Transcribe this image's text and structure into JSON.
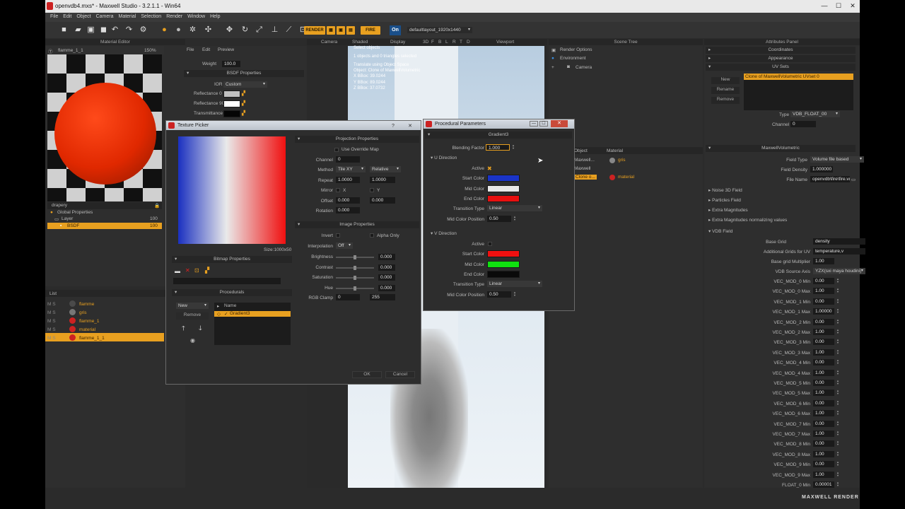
{
  "window": {
    "title": "openvdb4.mxs* - Maxwell Studio - 3.2.1.1 - Win64",
    "minimize": "—",
    "maximize": "☐",
    "close": "✕"
  },
  "menu": [
    "File",
    "Edit",
    "Object",
    "Camera",
    "Material",
    "Selection",
    "Render",
    "Window",
    "Help"
  ],
  "toolbar": {
    "render_label": "RENDER",
    "fire_label": "FIRE",
    "on_label": "On",
    "layout_label": "defaultlayout_1920x1440"
  },
  "material_editor": {
    "header": "Material Editor",
    "material_name": "flamme_1_1",
    "zoom": "150%",
    "preview_tab": "drapery",
    "menus": [
      "File",
      "Edit",
      "Preview"
    ],
    "weight_label": "Weight",
    "weight_value": "100.0",
    "bsdf_header": "BSDF Properties",
    "ior_label": "IOR",
    "ior_value": "Custom",
    "refl0_label": "Reflectance 0",
    "refl90_label": "Reflectance 90",
    "trans_label": "Transmittance",
    "tree": [
      {
        "label": "Global Properties",
        "value": ""
      },
      {
        "label": "Layer",
        "value": "100"
      },
      {
        "label": "BSDF",
        "value": "100"
      }
    ]
  },
  "list_panel": {
    "header": "List",
    "rows": [
      {
        "flags": "M  S",
        "name": "flamme"
      },
      {
        "flags": "M  S",
        "name": "gris"
      },
      {
        "flags": "M  S",
        "name": "flamme_1"
      },
      {
        "flags": "M  S",
        "name": "material"
      },
      {
        "flags": "M  S",
        "name": "flamme_1_1"
      }
    ]
  },
  "viewport": {
    "tabs": [
      "Camera",
      "Shaded",
      "Display",
      "3D",
      "F",
      "B",
      "L",
      "R",
      "T",
      "D",
      "Viewport"
    ],
    "info": [
      "Select objects",
      "1 objects and 0 triangles selected",
      "Translate using Object Space",
      "Object: Clone of MaxwellVolumetric",
      "X BBox: 39.0244",
      "Y BBox: 89.0244",
      "Z BBox: 37.0732"
    ]
  },
  "scene_tree": {
    "header": "Scene Tree",
    "items": [
      "Render Options",
      "Environment",
      "Camera"
    ],
    "columns": [
      "Object",
      "Material"
    ],
    "rows": [
      {
        "object": "Maxwell...",
        "material": "gris"
      },
      {
        "object": "Maxwell",
        "material": ""
      },
      {
        "object": "Clone o...",
        "material": "material"
      }
    ]
  },
  "attributes": {
    "header": "Attributes Panel",
    "sections": [
      "Coordinates",
      "Appearance",
      "UV Sets"
    ],
    "uv_name": "Clone of MaxwellVolumetric UVset 0",
    "buttons": [
      "New",
      "Rename",
      "Remove"
    ],
    "type_label": "Type",
    "type_value": "VDB_FLOAT_00",
    "channel_label": "Channel",
    "channel_value": "0",
    "volumetric_header": "MaxwellVolumetric",
    "field_type_label": "Field Type",
    "field_type_value": "Volume file based",
    "field_density_label": "Field Density",
    "field_density_value": "1.000000",
    "file_name_label": "File Name",
    "file_name_value": "openvdb\\fire\\fire.vdb",
    "collapsed": [
      "Noise 3D Field",
      "Particles Field",
      "Extra Magnitudes",
      "Extra Magnitudes normalizing values"
    ],
    "vdb_field": "VDB Field",
    "base_grid_label": "Base Grid",
    "base_grid_value": "density",
    "add_grids_label": "Additional Grids for UV",
    "add_grids_value": "temperature,v",
    "base_mult_label": "Base grid Multiplier",
    "base_mult_value": "1.00",
    "src_axis_label": "VDB Source Axis",
    "src_axis_value": "YZX(sxi maya houdini)",
    "vec_rows": [
      {
        "label": "VEC_MOD_0 Min",
        "value": "0.00"
      },
      {
        "label": "VEC_MOD_0 Max",
        "value": "1.00"
      },
      {
        "label": "VEC_MOD_1 Min",
        "value": "0.00"
      },
      {
        "label": "VEC_MOD_1 Max",
        "value": "1.00000"
      },
      {
        "label": "VEC_MOD_2 Min",
        "value": "0.00"
      },
      {
        "label": "VEC_MOD_2 Max",
        "value": "1.00"
      },
      {
        "label": "VEC_MOD_3 Min",
        "value": "0.00"
      },
      {
        "label": "VEC_MOD_3 Max",
        "value": "1.00"
      },
      {
        "label": "VEC_MOD_4 Min",
        "value": "0.00"
      },
      {
        "label": "VEC_MOD_4 Max",
        "value": "1.00"
      },
      {
        "label": "VEC_MOD_5 Min",
        "value": "0.00"
      },
      {
        "label": "VEC_MOD_5 Max",
        "value": "1.00"
      },
      {
        "label": "VEC_MOD_6 Min",
        "value": "0.00"
      },
      {
        "label": "VEC_MOD_6 Max",
        "value": "1.00"
      },
      {
        "label": "VEC_MOD_7 Min",
        "value": "0.00"
      },
      {
        "label": "VEC_MOD_7 Max",
        "value": "1.00"
      },
      {
        "label": "VEC_MOD_8 Min",
        "value": "0.00"
      },
      {
        "label": "VEC_MOD_8 Max",
        "value": "1.00"
      },
      {
        "label": "VEC_MOD_9 Min",
        "value": "0.00"
      },
      {
        "label": "VEC_MOD_9 Max",
        "value": "1.00"
      },
      {
        "label": "FLOAT_0 Min",
        "value": "0.00001"
      }
    ],
    "brand": "MAXWELL RENDER"
  },
  "texture_picker": {
    "title": "Texture Picker",
    "size_label": "Size:1000x50",
    "bitmap_header": "Bitmap Properties",
    "procedurals_header": "Procedurals",
    "new_label": "New",
    "remove_label": "Remove",
    "name_col": "Name",
    "procedural_item": "Gradient3",
    "projection_header": "Projection Properties",
    "use_override": "Use Override Map",
    "channel_label": "Channel",
    "channel_value": "0",
    "method_label": "Method",
    "method_value": "Tile XY",
    "method_value2": "Relative",
    "repeat_label": "Repeat",
    "repeat_x": "1.0000",
    "repeat_y": "1.0000",
    "mirror_label": "Mirror",
    "mirror_x": "X",
    "mirror_y": "Y",
    "offset_label": "Offset",
    "offset_x": "0.000",
    "offset_y": "0.000",
    "rotation_label": "Rotation",
    "rotation_value": "0.000",
    "image_header": "Image Properties",
    "invert_label": "Invert",
    "alpha_only": "Alpha Only",
    "interp_label": "Interpolation",
    "interp_value": "Off",
    "brightness_label": "Brightness",
    "brightness_value": "0.000",
    "contrast_label": "Contrast",
    "contrast_value": "0.000",
    "saturation_label": "Saturation",
    "saturation_value": "0.000",
    "hue_label": "Hue",
    "hue_value": "0.000",
    "clamp_label": "RGB Clamp",
    "clamp_min": "0",
    "clamp_max": "255",
    "ok_label": "OK",
    "cancel_label": "Cancel"
  },
  "procedural": {
    "title": "Procedural Parameters",
    "header": "Gradient3",
    "blending_label": "Blending Factor",
    "blending_value": "1.000",
    "u_direction": "U Direction",
    "v_direction": "V Direction",
    "active_label": "Active",
    "start_label": "Start Color",
    "mid_label": "Mid Color",
    "end_label": "End Color",
    "trans_label": "Transition Type",
    "trans_value": "Linear",
    "midpos_label": "Mid Color Position",
    "u_midpos": "0.50",
    "v_midpos": "0.50",
    "colors": {
      "u_start": "#1a34c8",
      "u_mid": "#e8e8e8",
      "u_end": "#e81010",
      "v_start": "#f01010",
      "v_mid": "#10e010",
      "v_end": "#0a0a0a"
    }
  }
}
